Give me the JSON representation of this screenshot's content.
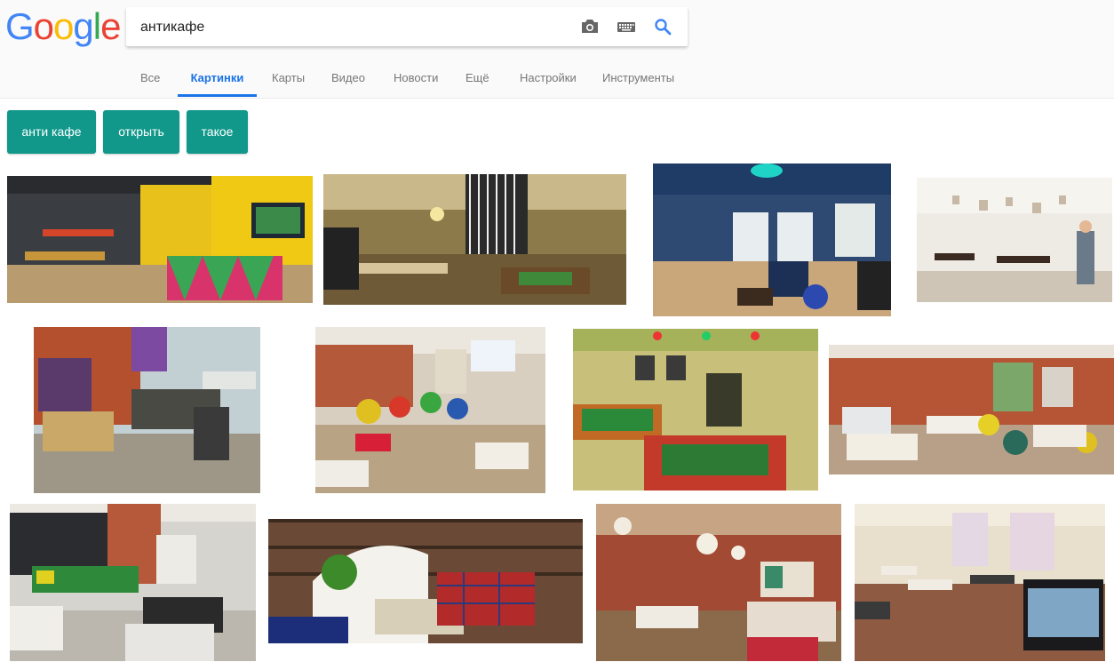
{
  "search": {
    "query": "антикафе"
  },
  "logo": {
    "letters": [
      "G",
      "o",
      "o",
      "g",
      "l",
      "e"
    ],
    "colors": [
      "#4285F4",
      "#EA4335",
      "#FBBC05",
      "#4285F4",
      "#34A853",
      "#EA4335"
    ]
  },
  "icons": {
    "camera": "camera-icon",
    "keyboard": "keyboard-icon",
    "search": "search-icon"
  },
  "tabs": [
    {
      "label": "Все"
    },
    {
      "label": "Картинки",
      "active": true
    },
    {
      "label": "Карты"
    },
    {
      "label": "Видео"
    },
    {
      "label": "Новости"
    },
    {
      "label": "Ещё"
    },
    {
      "label": "Настройки"
    },
    {
      "label": "Инструменты"
    }
  ],
  "chips": [
    "анти кафе",
    "открыть",
    "такое"
  ],
  "colors": {
    "accent": "#1a73e8",
    "chip": "#11988b"
  }
}
